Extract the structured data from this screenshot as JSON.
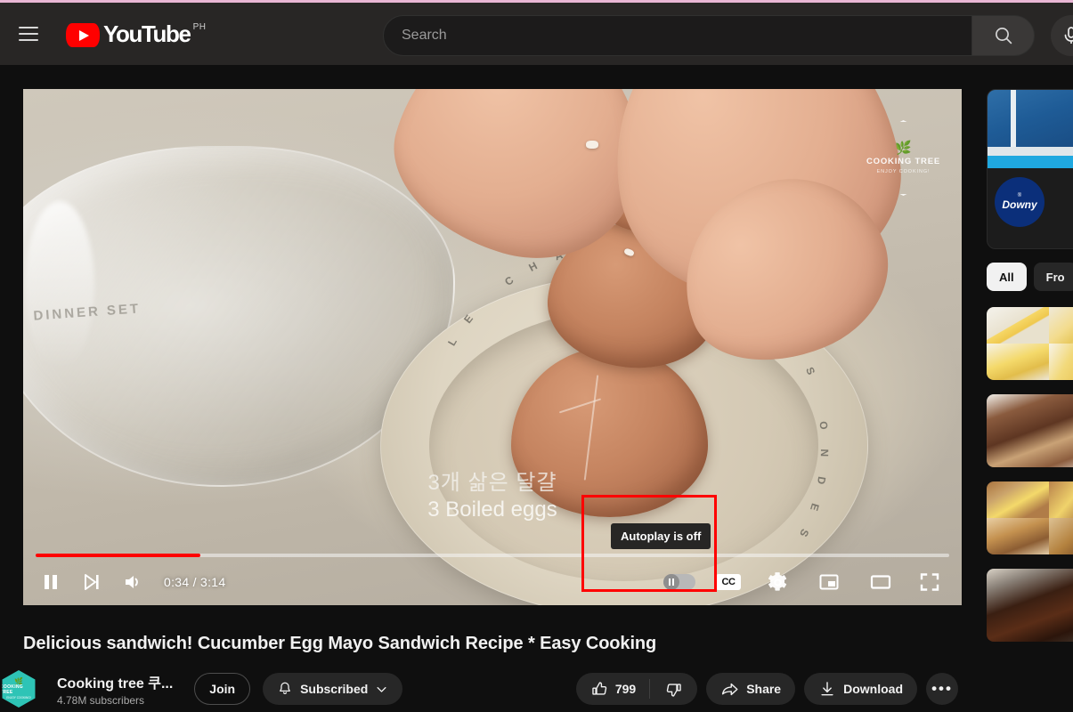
{
  "masthead": {
    "menu_icon": "hamburger-menu-icon",
    "logo_text": "YouTube",
    "logo_country": "PH",
    "search_placeholder": "Search",
    "search_value": "",
    "search_icon": "search-icon",
    "mic_icon": "microphone-icon"
  },
  "player": {
    "watermark": {
      "leaf_icon": "leaf-icon",
      "name": "COOKING TREE",
      "tagline": "ENJOY COOKING!"
    },
    "captions": {
      "korean": "3개 삶은 달걀",
      "english": "3 Boiled eggs"
    },
    "bowl_text_left": "DINNER SET",
    "bowl_ring_text": "LE CHAUD AVEC DES ONDES",
    "controls": {
      "pause_icon": "pause-icon",
      "next_icon": "next-video-icon",
      "volume_icon": "volume-on-icon",
      "time_current": "0:34",
      "time_total": "3:14",
      "time_display": "0:34 / 3:14",
      "progress_percent": 18,
      "autoplay_icon": "autoplay-toggle",
      "autoplay_state": "off",
      "captions_label": "CC",
      "settings_icon": "gear-icon",
      "miniplayer_icon": "miniplayer-icon",
      "theater_icon": "theater-mode-icon",
      "fullscreen_icon": "fullscreen-icon"
    },
    "tooltip": "Autoplay is off",
    "annotation_color": "#ff0000"
  },
  "video": {
    "title": "Delicious sandwich! Cucumber Egg Mayo Sandwich Recipe * Easy Cooking",
    "channel_name": "Cooking tree 쿠...",
    "channel_subs": "4.78M subscribers",
    "avatar_text": "COOKING TREE",
    "avatar_sub": "ENJOY COOKING!",
    "join_label": "Join",
    "subscribe_label": "Subscribed",
    "bell_icon": "bell-icon",
    "chevron_icon": "chevron-down-icon",
    "like_icon": "thumbs-up-icon",
    "like_count": "799",
    "dislike_icon": "thumbs-down-icon",
    "share_icon": "share-icon",
    "share_label": "Share",
    "download_icon": "download-icon",
    "download_label": "Download",
    "more_label": "•••"
  },
  "sidebar": {
    "ad": {
      "brand": "Downy",
      "mark": "®"
    },
    "chips": [
      {
        "label": "All",
        "active": true
      },
      {
        "label": "Fro",
        "active": false
      }
    ],
    "thumbnails": [
      {
        "name": "mango-cheesecake-thumbnail"
      },
      {
        "name": "chocolate-cake-thumbnail"
      },
      {
        "name": "egg-sandwich-thumbnail"
      },
      {
        "name": "coffee-drinks-thumbnail"
      }
    ]
  },
  "colors": {
    "brand_red": "#ff0000",
    "bg": "#0f0f0f",
    "masthead_bg": "#282625",
    "accent_chip": "#f1f1f1",
    "annotation": "#ff0000",
    "avatar_teal": "#2ec4b6",
    "downy_blue": "#0b2f7a"
  }
}
